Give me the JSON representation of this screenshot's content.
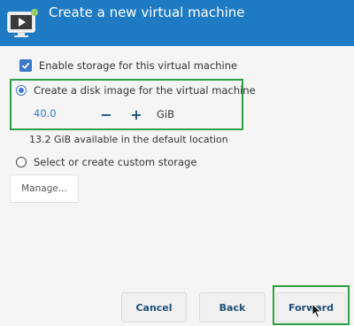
{
  "window": {
    "title": "Create a new virtual machine"
  },
  "storage": {
    "enable_label": "Enable storage for this virtual machine",
    "enable_checked": true,
    "disk_image_label": "Create a disk image for the virtual machine",
    "disk_image_selected": true,
    "size_value": "40.0",
    "minus_label": "−",
    "plus_label": "+",
    "unit": "GiB",
    "available_text": "13.2 GiB available in the default location",
    "custom_label": "Select or create custom storage",
    "custom_selected": false,
    "manage_label": "Manage..."
  },
  "footer": {
    "cancel_label": "Cancel",
    "back_label": "Back",
    "forward_label": "Forward"
  },
  "colors": {
    "header": "#1f7ac4",
    "accent": "#3c79c8",
    "highlight": "#2ea043"
  },
  "icons": {
    "header": "virtual-machine-icon",
    "checkbox": "checkmark-icon",
    "cursor": "mouse-pointer-icon"
  }
}
